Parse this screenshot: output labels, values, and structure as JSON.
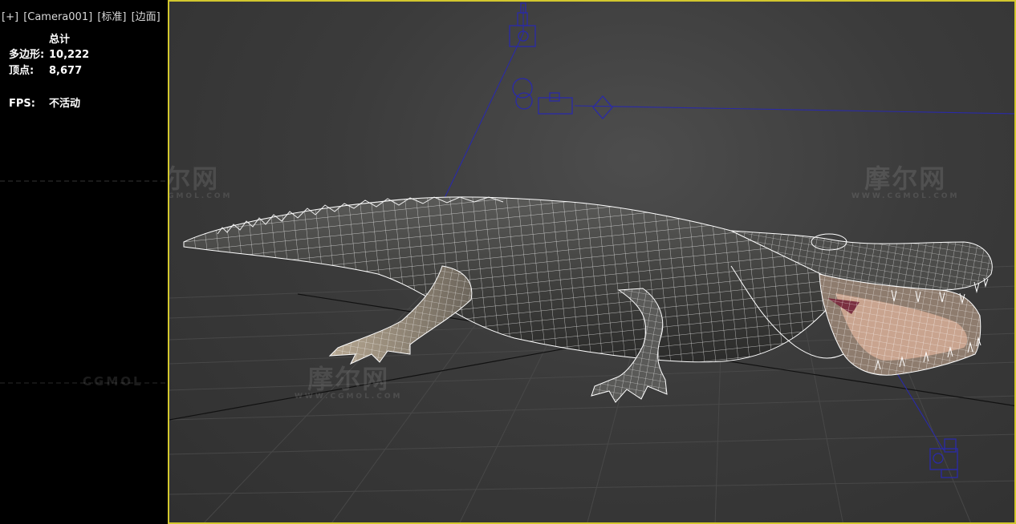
{
  "viewport": {
    "labels": [
      "[+]",
      "[Camera001]",
      "[标准]",
      "[边面]"
    ]
  },
  "stats": {
    "header": "总计",
    "polygons_label": "多边形:",
    "polygons_value": "10,222",
    "vertices_label": "顶点:",
    "vertices_value": "8,677",
    "fps_label": "FPS:",
    "fps_value": "不活动"
  },
  "watermark": {
    "text": "摩尔网",
    "sub": "WWW.CGMOL.COM",
    "brand": "CGMOL"
  },
  "colors": {
    "viewport_border": "#d2c72e",
    "camera_blue": "#2a2aa8",
    "wireframe": "#ffffff"
  },
  "icons": [
    "camera-icon",
    "camera-target-icon"
  ]
}
